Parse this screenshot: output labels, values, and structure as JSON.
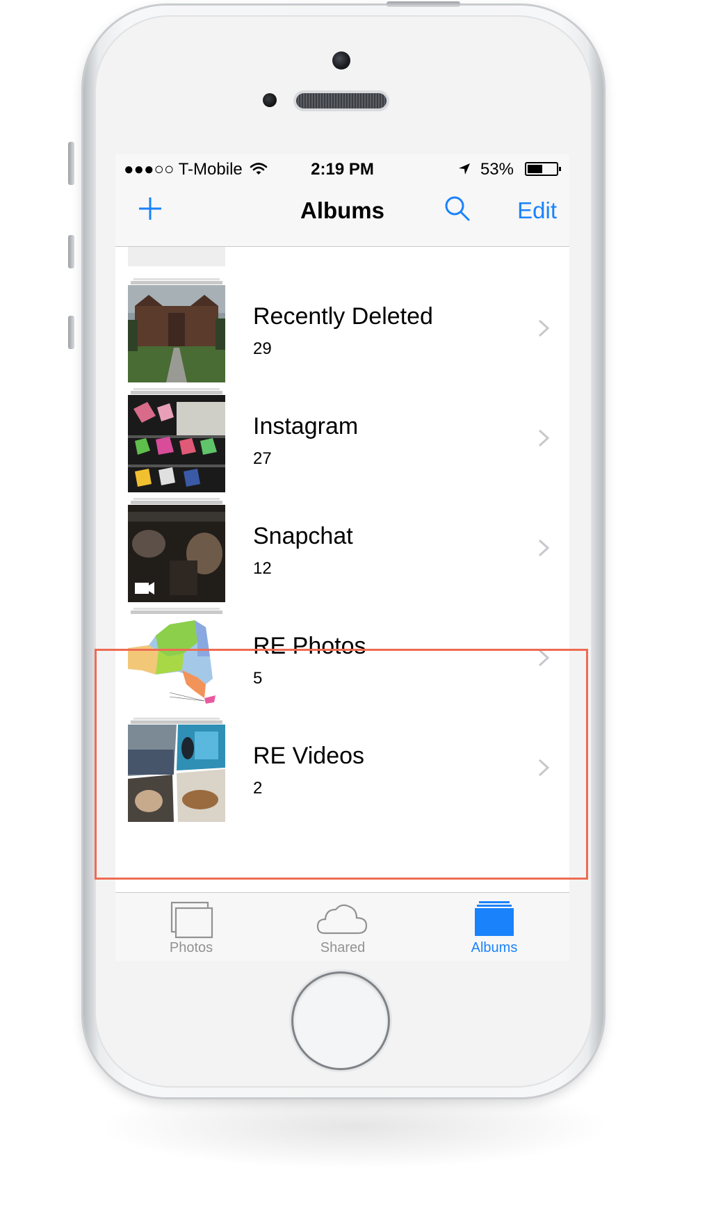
{
  "status_bar": {
    "signal": "●●●○○",
    "carrier": "T-Mobile",
    "time": "2:19 PM",
    "battery_percent": "53%",
    "battery_level": 0.53
  },
  "nav": {
    "title": "Albums",
    "edit_label": "Edit"
  },
  "albums": [
    {
      "title": "Recently Deleted",
      "count": "29"
    },
    {
      "title": "Instagram",
      "count": "27"
    },
    {
      "title": "Snapchat",
      "count": "12"
    },
    {
      "title": "RE Photos",
      "count": "5"
    },
    {
      "title": "RE Videos",
      "count": "2"
    }
  ],
  "tabs": [
    {
      "label": "Photos",
      "icon": "photos-icon",
      "active": false
    },
    {
      "label": "Shared",
      "icon": "cloud-icon",
      "active": false
    },
    {
      "label": "Albums",
      "icon": "albums-icon",
      "active": true
    }
  ],
  "colors": {
    "accent": "#1a82fb",
    "inactive": "#929292",
    "highlight_border": "#ee6b52"
  }
}
